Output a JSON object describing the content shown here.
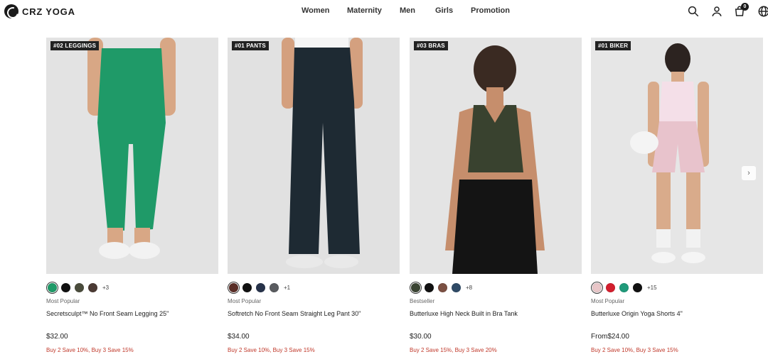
{
  "header": {
    "logo_text": "CRZ YOGA",
    "nav": [
      "Women",
      "Maternity",
      "Men",
      "Girls",
      "Promotion"
    ],
    "cart_count": "0",
    "icons": [
      "search-icon",
      "user-icon",
      "cart-icon",
      "globe-icon"
    ]
  },
  "products": [
    {
      "tag": "#02 LEGGINGS",
      "swatches": [
        "#1f9a68",
        "#111111",
        "#4a4c3c",
        "#4b3a34"
      ],
      "more": "+3",
      "subtitle": "Most Popular",
      "name": "Secretsculpt™ No Front Seam Legging 25\"",
      "price": "$32.00",
      "promo": "Buy 2 Save 10%, Buy 3 Save 15%",
      "image_colors": {
        "bg": "#e3e3e3",
        "garment": "#1f9a68",
        "skin": "#d8a785",
        "shoe": "#f2f2f2"
      }
    },
    {
      "tag": "#01 PANTS",
      "swatches": [
        "#5a2e27",
        "#111111",
        "#27324a",
        "#5a5c60"
      ],
      "more": "+1",
      "subtitle": "Most Popular",
      "name": "Softretch No Front Seam Straight Leg Pant 30\"",
      "price": "$34.00",
      "promo": "Buy 2 Save 10%, Buy 3 Save 15%",
      "image_colors": {
        "bg": "#e1e1e1",
        "garment": "#1e2a33",
        "skin": "#d4a07f",
        "shoe": "#e9e9e9"
      }
    },
    {
      "tag": "#03 BRAS",
      "swatches": [
        "#3b4433",
        "#111111",
        "#7b5043",
        "#2f4a66"
      ],
      "more": "+8",
      "subtitle": "Bestseller",
      "name": "Butterluxe High Neck Built in Bra Tank",
      "price": "$30.00",
      "promo": "Buy 2 Save 15%, Buy 3 Save 20%",
      "image_colors": {
        "bg": "#e4e4e4",
        "garment": "#39422f",
        "skin": "#c68e6c",
        "pants": "#141414"
      }
    },
    {
      "tag": "#01 BIKER",
      "swatches": [
        "#e9c6c8",
        "#d31f2e",
        "#1f9a7a",
        "#111111"
      ],
      "more": "+15",
      "subtitle": "Most Popular",
      "name": "Butterluxe Origin Yoga Shorts 4\"",
      "price": "From$24.00",
      "promo": "Buy 2 Save 10%, Buy 3 Save 15%",
      "image_colors": {
        "bg": "#e6e6e6",
        "garment": "#e8c3cc",
        "skin": "#d9ab8b",
        "top": "#f4dfe8"
      }
    }
  ],
  "carousel": {
    "next_icon": "chevron-right-icon"
  }
}
